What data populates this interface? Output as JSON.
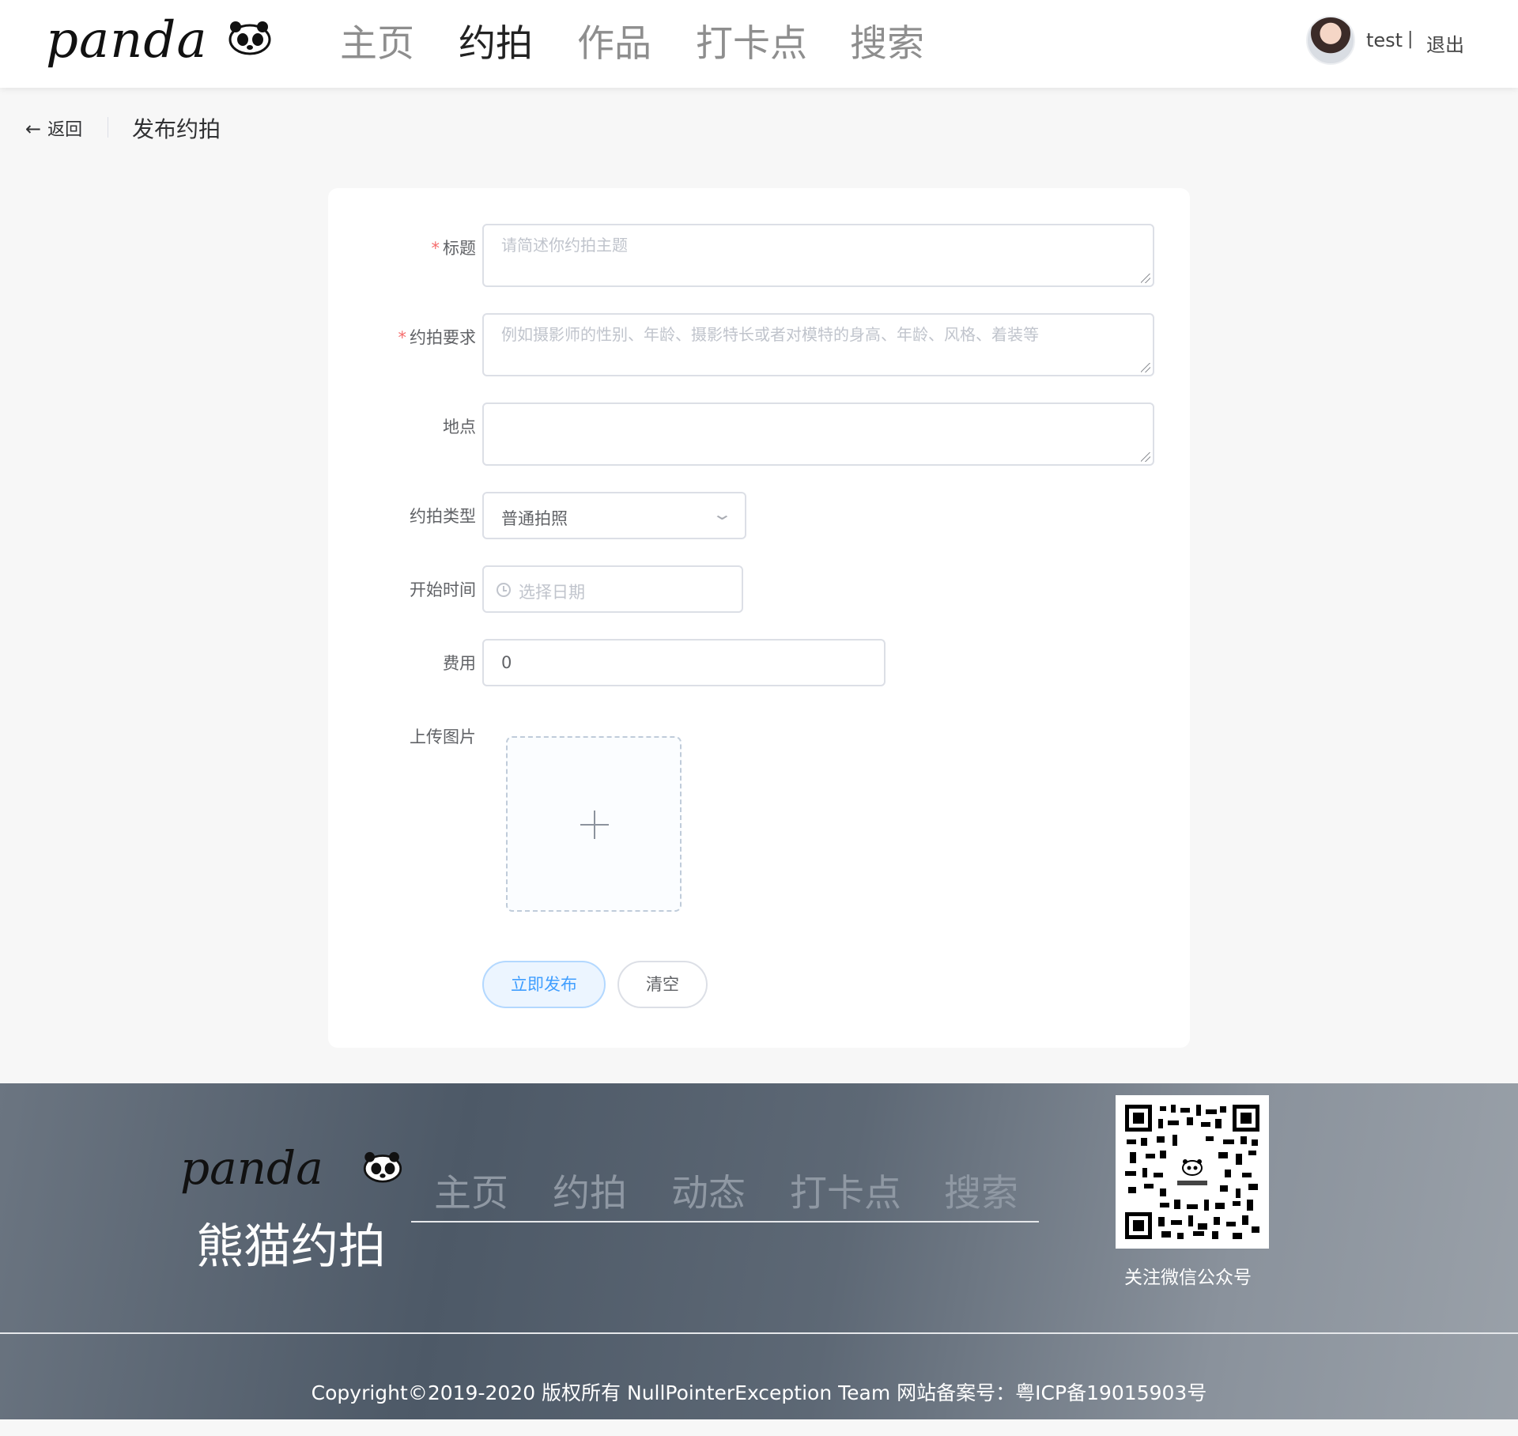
{
  "header": {
    "logo_text": "panda",
    "nav": [
      {
        "label": "主页"
      },
      {
        "label": "约拍"
      },
      {
        "label": "作品"
      },
      {
        "label": "打卡点"
      },
      {
        "label": "搜索"
      }
    ],
    "active_nav": "约拍",
    "username": "test",
    "separator": "|",
    "logout_label": "退出"
  },
  "page_header": {
    "back_label": "返回",
    "title": "发布约拍"
  },
  "form": {
    "title": {
      "label": "标题",
      "required": true,
      "placeholder": "请简述你约拍主题",
      "value": ""
    },
    "requirements": {
      "label": "约拍要求",
      "required": true,
      "placeholder": "例如摄影师的性别、年龄、摄影特长或者对模特的身高、年龄、风格、着装等",
      "value": ""
    },
    "location": {
      "label": "地点",
      "required": false,
      "placeholder": "",
      "value": ""
    },
    "type": {
      "label": "约拍类型",
      "selected": "普通拍照"
    },
    "start_time": {
      "label": "开始时间",
      "placeholder": "选择日期"
    },
    "cost": {
      "label": "费用",
      "value": "0"
    },
    "upload": {
      "label": "上传图片"
    },
    "submit_label": "立即发布",
    "clear_label": "清空",
    "required_mark": "*"
  },
  "footer": {
    "logo_text": "panda",
    "brand": "熊猫约拍",
    "nav": [
      {
        "label": "主页"
      },
      {
        "label": "约拍"
      },
      {
        "label": "动态"
      },
      {
        "label": "打卡点"
      },
      {
        "label": "搜索"
      }
    ],
    "qr_caption": "关注微信公众号",
    "copyright": "Copyright©2019-2020 版权所有 NullPointerException Team 网站备案号：粤ICP备19015903号"
  },
  "colors": {
    "primary": "#409eff",
    "required": "#f56c6c",
    "footer_bg": "#4d5967"
  },
  "icons": [
    "panda-icon",
    "arrow-left-icon",
    "chevron-down-icon",
    "clock-icon",
    "plus-icon",
    "qr-code"
  ]
}
